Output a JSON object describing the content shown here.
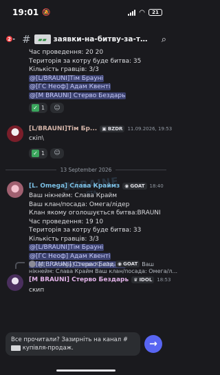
{
  "status": {
    "time": "19:01",
    "battery": "21"
  },
  "header": {
    "badge": "2",
    "channel_name": "заявки-на-битву-за-т..."
  },
  "msg_top": {
    "lines": [
      "Час проведення: 20 20",
      "Територія за котру буде битва: 35",
      "Кількість гравців: 3/3"
    ],
    "mentions": [
      "@[L/BRAUNI]Тім Брауні",
      "@[ГС Неоф] Адам Квенті",
      "@[M BRAUNI]  Стерво Бездарь"
    ],
    "reaction_count": "1"
  },
  "msg_tim": {
    "username": "[L/BRAUNI]Тім Бр...",
    "tag": "BZDR",
    "timestamp": "11.09.2026, 19:53",
    "text": "скіп\\",
    "reaction_count": "1",
    "colors": {
      "username": "#d4b4a8"
    }
  },
  "divider": {
    "date": "13 September 2026"
  },
  "watermark": {
    "line1": "UKRAINE",
    "line2": "GTA"
  },
  "msg_omega": {
    "username": "[L. Omega] Слава Краймз",
    "tag": "GOAT",
    "timestamp": "18:40",
    "lines": [
      "Ваш нікнейм: Слава Крайм",
      "Ваш клан/посада: Омега/лідер",
      "Клан якому оголошується битва:BRAUNI",
      "Час проведення: 19 10",
      "Територія за котру буде битва: 33",
      "Кількість гравців: 3/3"
    ],
    "mentions": [
      "@[L/BRAUNI]Тім Брауні",
      "@[ГС Неоф] Адам Квенті",
      "@[M BRAUNI]  Стерво Бездарь"
    ],
    "colors": {
      "username": "#7cc1e6"
    }
  },
  "reply": {
    "name": "@[L. Omega] Слава Крайм",
    "tag": "GOAT",
    "text_tail": "Ваш",
    "text_line2": "нікнейм: Слава Крайм Ваш клан/посада: Омега/л..."
  },
  "msg_sterv": {
    "username": "[M BRAUNI]  Стерво Бездарь",
    "tag": "IDOL",
    "timestamp": "18:53",
    "text": "скип",
    "colors": {
      "username": "#e2b3e8"
    }
  },
  "composer": {
    "line1": "Все прочитали? Зазирніть на канал #",
    "line2": "купівля-продаж."
  },
  "colors": {
    "accent": "#5865f2",
    "mention_bg": "#3c4270",
    "background": "#1a1a1e"
  }
}
